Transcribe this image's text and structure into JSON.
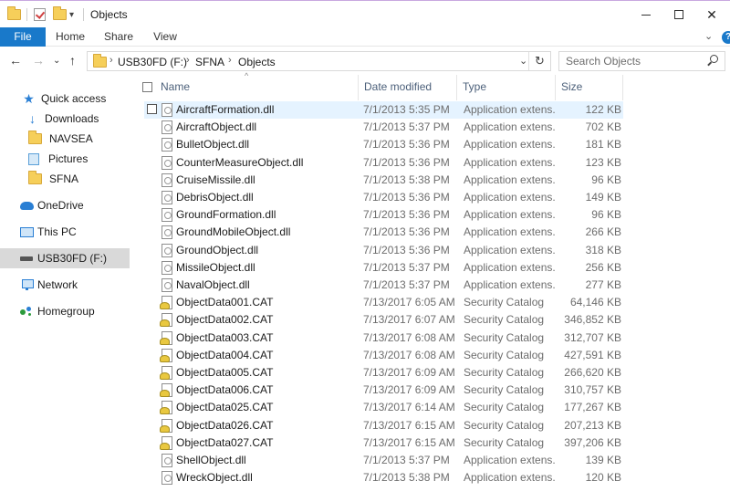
{
  "window": {
    "title": "Objects"
  },
  "ribbon": {
    "tabs": [
      "File",
      "Home",
      "Share",
      "View"
    ]
  },
  "address": {
    "crumbs": [
      "USB30FD (F:)",
      "SFNA",
      "Objects"
    ]
  },
  "search": {
    "placeholder": "Search Objects"
  },
  "nav": {
    "items": [
      {
        "label": "Quick access",
        "icon": "star-icon"
      },
      {
        "label": "Downloads",
        "icon": "download-icon"
      },
      {
        "label": "NAVSEA",
        "icon": "folder-icon"
      },
      {
        "label": "Pictures",
        "icon": "pictures-icon"
      },
      {
        "label": "SFNA",
        "icon": "folder-icon"
      },
      {
        "label": "OneDrive",
        "icon": "cloud-icon"
      },
      {
        "label": "This PC",
        "icon": "computer-icon"
      },
      {
        "label": "USB30FD (F:)",
        "icon": "drive-icon"
      },
      {
        "label": "Network",
        "icon": "network-icon"
      },
      {
        "label": "Homegroup",
        "icon": "homegroup-icon"
      }
    ]
  },
  "columns": {
    "name": "Name",
    "date": "Date modified",
    "type": "Type",
    "size": "Size"
  },
  "files": [
    {
      "name": "AircraftFormation.dll",
      "date": "7/1/2013 5:35 PM",
      "type": "Application extens...",
      "size": "122 KB",
      "kind": "dll"
    },
    {
      "name": "AircraftObject.dll",
      "date": "7/1/2013 5:37 PM",
      "type": "Application extens...",
      "size": "702 KB",
      "kind": "dll"
    },
    {
      "name": "BulletObject.dll",
      "date": "7/1/2013 5:36 PM",
      "type": "Application extens...",
      "size": "181 KB",
      "kind": "dll"
    },
    {
      "name": "CounterMeasureObject.dll",
      "date": "7/1/2013 5:36 PM",
      "type": "Application extens...",
      "size": "123 KB",
      "kind": "dll"
    },
    {
      "name": "CruiseMissile.dll",
      "date": "7/1/2013 5:38 PM",
      "type": "Application extens...",
      "size": "96 KB",
      "kind": "dll"
    },
    {
      "name": "DebrisObject.dll",
      "date": "7/1/2013 5:36 PM",
      "type": "Application extens...",
      "size": "149 KB",
      "kind": "dll"
    },
    {
      "name": "GroundFormation.dll",
      "date": "7/1/2013 5:36 PM",
      "type": "Application extens...",
      "size": "96 KB",
      "kind": "dll"
    },
    {
      "name": "GroundMobileObject.dll",
      "date": "7/1/2013 5:36 PM",
      "type": "Application extens...",
      "size": "266 KB",
      "kind": "dll"
    },
    {
      "name": "GroundObject.dll",
      "date": "7/1/2013 5:36 PM",
      "type": "Application extens...",
      "size": "318 KB",
      "kind": "dll"
    },
    {
      "name": "MissileObject.dll",
      "date": "7/1/2013 5:37 PM",
      "type": "Application extens...",
      "size": "256 KB",
      "kind": "dll"
    },
    {
      "name": "NavalObject.dll",
      "date": "7/1/2013 5:37 PM",
      "type": "Application extens...",
      "size": "277 KB",
      "kind": "dll"
    },
    {
      "name": "ObjectData001.CAT",
      "date": "7/13/2017 6:05 AM",
      "type": "Security Catalog",
      "size": "64,146 KB",
      "kind": "cat"
    },
    {
      "name": "ObjectData002.CAT",
      "date": "7/13/2017 6:07 AM",
      "type": "Security Catalog",
      "size": "346,852 KB",
      "kind": "cat"
    },
    {
      "name": "ObjectData003.CAT",
      "date": "7/13/2017 6:08 AM",
      "type": "Security Catalog",
      "size": "312,707 KB",
      "kind": "cat"
    },
    {
      "name": "ObjectData004.CAT",
      "date": "7/13/2017 6:08 AM",
      "type": "Security Catalog",
      "size": "427,591 KB",
      "kind": "cat"
    },
    {
      "name": "ObjectData005.CAT",
      "date": "7/13/2017 6:09 AM",
      "type": "Security Catalog",
      "size": "266,620 KB",
      "kind": "cat"
    },
    {
      "name": "ObjectData006.CAT",
      "date": "7/13/2017 6:09 AM",
      "type": "Security Catalog",
      "size": "310,757 KB",
      "kind": "cat"
    },
    {
      "name": "ObjectData025.CAT",
      "date": "7/13/2017 6:14 AM",
      "type": "Security Catalog",
      "size": "177,267 KB",
      "kind": "cat"
    },
    {
      "name": "ObjectData026.CAT",
      "date": "7/13/2017 6:15 AM",
      "type": "Security Catalog",
      "size": "207,213 KB",
      "kind": "cat"
    },
    {
      "name": "ObjectData027.CAT",
      "date": "7/13/2017 6:15 AM",
      "type": "Security Catalog",
      "size": "397,206 KB",
      "kind": "cat"
    },
    {
      "name": "ShellObject.dll",
      "date": "7/1/2013 5:37 PM",
      "type": "Application extens...",
      "size": "139 KB",
      "kind": "dll"
    },
    {
      "name": "WreckObject.dll",
      "date": "7/1/2013 5:38 PM",
      "type": "Application extens...",
      "size": "120 KB",
      "kind": "dll"
    }
  ],
  "colors": {
    "accent": "#1979ca",
    "hover_row": "#e5f3ff",
    "selected_nav": "#d9d9d9"
  }
}
